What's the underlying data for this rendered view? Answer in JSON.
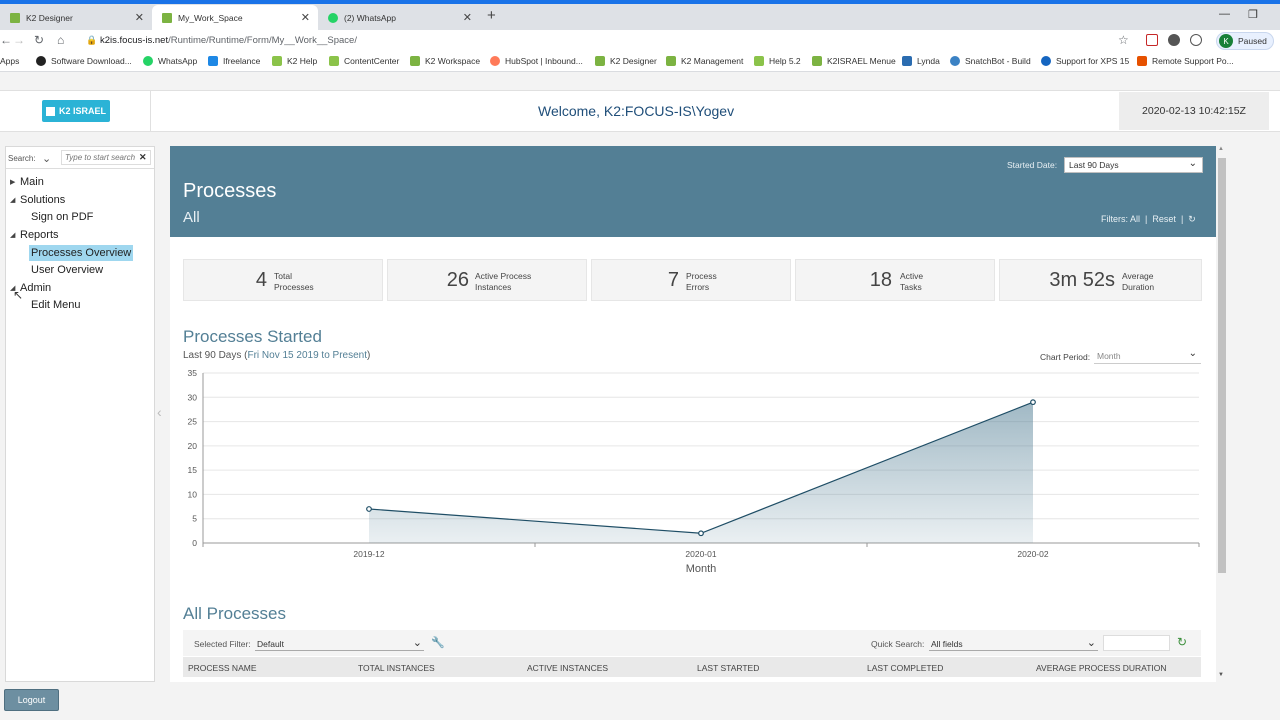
{
  "browser": {
    "tabs": [
      {
        "title": "K2 Designer"
      },
      {
        "title": "My_Work_Space"
      },
      {
        "title": "(2) WhatsApp"
      }
    ],
    "url_domain": "k2is.focus-is.net",
    "url_path": "/Runtime/Runtime/Form/My__Work__Space/",
    "profile_initial": "K",
    "profile_status": "Paused",
    "bookmarks": [
      {
        "label": "Apps",
        "color": "#4285f4"
      },
      {
        "label": "Software Download...",
        "color": "#222222"
      },
      {
        "label": "WhatsApp",
        "color": "#25d366"
      },
      {
        "label": "Ifreelance",
        "color": "#1e88e5"
      },
      {
        "label": "K2 Help",
        "color": "#8bc34a"
      },
      {
        "label": "ContentCenter",
        "color": "#8bc34a"
      },
      {
        "label": "K2 Workspace",
        "color": "#7cb342"
      },
      {
        "label": "HubSpot | Inbound...",
        "color": "#ff7a59"
      },
      {
        "label": "K2 Designer",
        "color": "#7cb342"
      },
      {
        "label": "K2 Management",
        "color": "#7cb342"
      },
      {
        "label": "Help 5.2",
        "color": "#8bc34a"
      },
      {
        "label": "K2ISRAEL Menue",
        "color": "#7cb342"
      },
      {
        "label": "Lynda",
        "color": "#2b6cb0"
      },
      {
        "label": "SnatchBot - Build",
        "color": "#3b82c4"
      },
      {
        "label": "Support for XPS 15",
        "color": "#1565c0"
      },
      {
        "label": "Remote Support Po...",
        "color": "#e65100"
      }
    ]
  },
  "header": {
    "logo_text": "K2 ISRAEL",
    "welcome": "Welcome, K2:FOCUS-IS\\Yogev",
    "datetime": "2020-02-13 10:42:15Z"
  },
  "sidebar": {
    "search_label": "Search:",
    "search_placeholder": "Type to start search",
    "items": [
      {
        "label": "Main",
        "level": 0,
        "arrow": "▸"
      },
      {
        "label": "Solutions",
        "level": 0,
        "arrow": "◢"
      },
      {
        "label": "Sign on PDF",
        "level": 1
      },
      {
        "label": "Reports",
        "level": 0,
        "arrow": "◢"
      },
      {
        "label": "Processes Overview",
        "level": 1,
        "selected": true
      },
      {
        "label": "User Overview",
        "level": 1
      },
      {
        "label": "Admin",
        "level": 0,
        "arrow": "◢"
      },
      {
        "label": "Edit Menu",
        "level": 1
      }
    ],
    "logout_label": "Logout"
  },
  "main": {
    "title": "Processes",
    "subtitle": "All",
    "started_date_label": "Started Date:",
    "started_date_value": "Last 90 Days",
    "filters_label": "Filters:",
    "filters_all": "All",
    "filters_sep": "|",
    "filters_reset": "Reset",
    "stats": [
      {
        "value": "4",
        "label_line1": "Total",
        "label_line2": "Processes"
      },
      {
        "value": "26",
        "label_line1": "Active Process",
        "label_line2": "Instances"
      },
      {
        "value": "7",
        "label_line1": "Process",
        "label_line2": "Errors"
      },
      {
        "value": "18",
        "label_line1": "Active",
        "label_line2": "Tasks"
      },
      {
        "value": "3m 52s",
        "label_line1": "Average",
        "label_line2": "Duration"
      }
    ],
    "chart_title": "Processes Started",
    "chart_subtitle_prefix": "Last 90 Days (",
    "chart_subtitle_range": "Fri Nov 15 2019 to Present",
    "chart_subtitle_suffix": ")",
    "chart_period_label": "Chart Period:",
    "chart_period_value": "Month",
    "all_processes_title": "All Processes",
    "selected_filter_label": "Selected Filter:",
    "selected_filter_value": "Default",
    "quick_search_label": "Quick Search:",
    "quick_search_value": "All fields",
    "columns": [
      "PROCESS NAME",
      "TOTAL INSTANCES",
      "ACTIVE INSTANCES",
      "LAST STARTED",
      "LAST COMPLETED",
      "AVERAGE PROCESS DURATION"
    ]
  },
  "chart_data": {
    "type": "area",
    "categories": [
      "2019-12",
      "2020-01",
      "2020-02"
    ],
    "values": [
      7,
      2,
      29
    ],
    "xlabel": "Month",
    "ylabel": "",
    "ylim": [
      0,
      35
    ],
    "yticks": [
      0,
      5,
      10,
      15,
      20,
      25,
      30,
      35
    ],
    "grid": true,
    "line_color": "#1f4e66",
    "fill_color": "#537f95"
  }
}
